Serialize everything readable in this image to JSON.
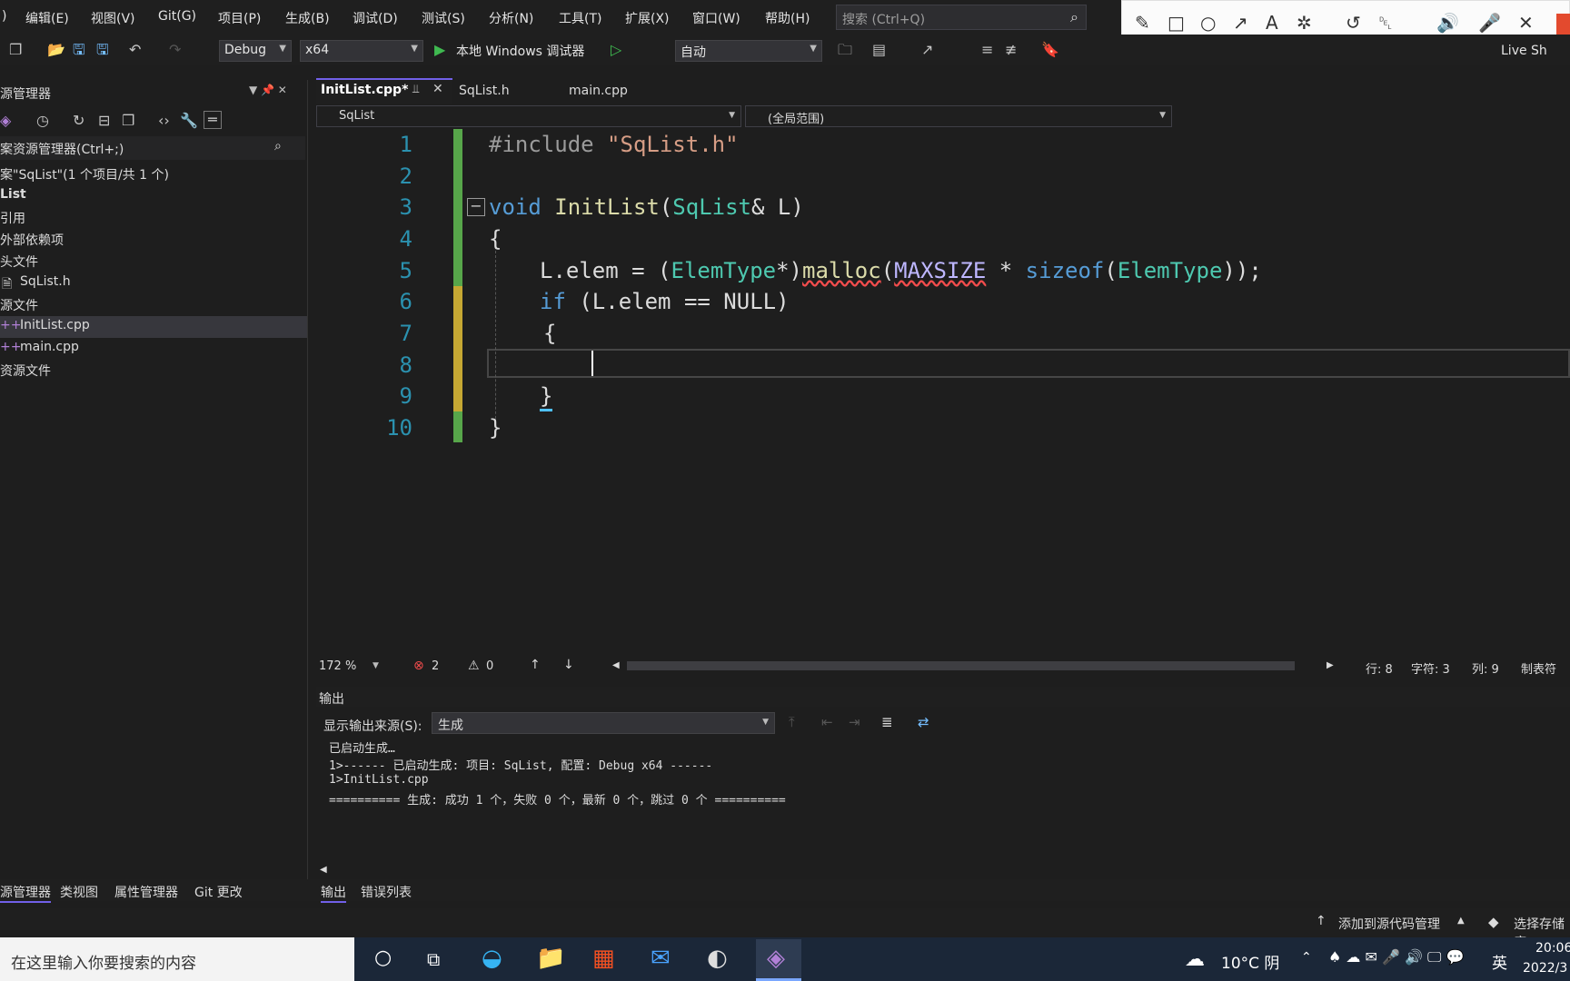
{
  "menu": [
    "编辑(E)",
    "视图(V)",
    "Git(G)",
    "项目(P)",
    "生成(B)",
    "调试(D)",
    "测试(S)",
    "分析(N)",
    "工具(T)",
    "扩展(X)",
    "窗口(W)",
    "帮助(H)"
  ],
  "search": {
    "placeholder": "搜索 (Ctrl+Q)"
  },
  "toolbar": {
    "config": "Debug",
    "platform": "x64",
    "run_label": "本地 Windows 调试器",
    "mode": "自动",
    "live_share": "Live Sh"
  },
  "solution_explorer": {
    "title": "源管理器",
    "search_placeholder": "案资源管理器(Ctrl+;)",
    "solution": "案\"SqList\"(1 个项目/共 1 个)",
    "project": "List",
    "items": [
      "引用",
      "外部依赖项",
      "头文件",
      "SqList.h",
      "源文件",
      "InitList.cpp",
      "main.cpp",
      "资源文件"
    ]
  },
  "tabs": [
    "InitList.cpp*",
    "SqList.h",
    "main.cpp"
  ],
  "nav": {
    "scope_left": "SqList",
    "scope_right": "(全局范围)"
  },
  "code": {
    "line_numbers": [
      "1",
      "2",
      "3",
      "4",
      "5",
      "6",
      "7",
      "8",
      "9",
      "10"
    ],
    "l1": "#include \"SqList.h\"",
    "l3_kw": "void",
    "l3_fn": "InitList",
    "l3_ty": "SqList",
    "l3_rest": "& L)",
    "l5_a": "L.elem = (",
    "l5_ty": "ElemType",
    "l5_b": "*)",
    "l5_fn": "malloc",
    "l5_mc": "MAXSIZE",
    "l5_c": " * ",
    "l5_kw": "sizeof",
    "l5_ty2": "ElemType",
    "l5_d": "));",
    "l6_kw": "if",
    "l6_rest": " (L.elem == NULL)"
  },
  "editor_status": {
    "zoom": "172 %",
    "errors": "2",
    "warnings": "0",
    "line": "行: 8",
    "char": "字符: 3",
    "col": "列: 9",
    "tabs": "制表符"
  },
  "output": {
    "title": "输出",
    "source_label": "显示输出来源(S):",
    "source_value": "生成",
    "lines": [
      "已启动生成…",
      "1>------ 已启动生成: 项目: SqList, 配置: Debug x64 ------",
      "1>InitList.cpp",
      "========== 生成: 成功 1 个，失败 0 个，最新 0 个，跳过 0 个 =========="
    ]
  },
  "bottom_tabs_left": [
    "源管理器",
    "类视图",
    "属性管理器",
    "Git 更改"
  ],
  "bottom_tabs_right": [
    "输出",
    "错误列表"
  ],
  "statusbar": {
    "source_control": "添加到源代码管理",
    "repo": "选择存储库"
  },
  "taskbar": {
    "search": "在这里输入你要搜索的内容",
    "weather": "10°C 阴",
    "ime": "英",
    "time": "20:06",
    "date": "2022/3"
  }
}
